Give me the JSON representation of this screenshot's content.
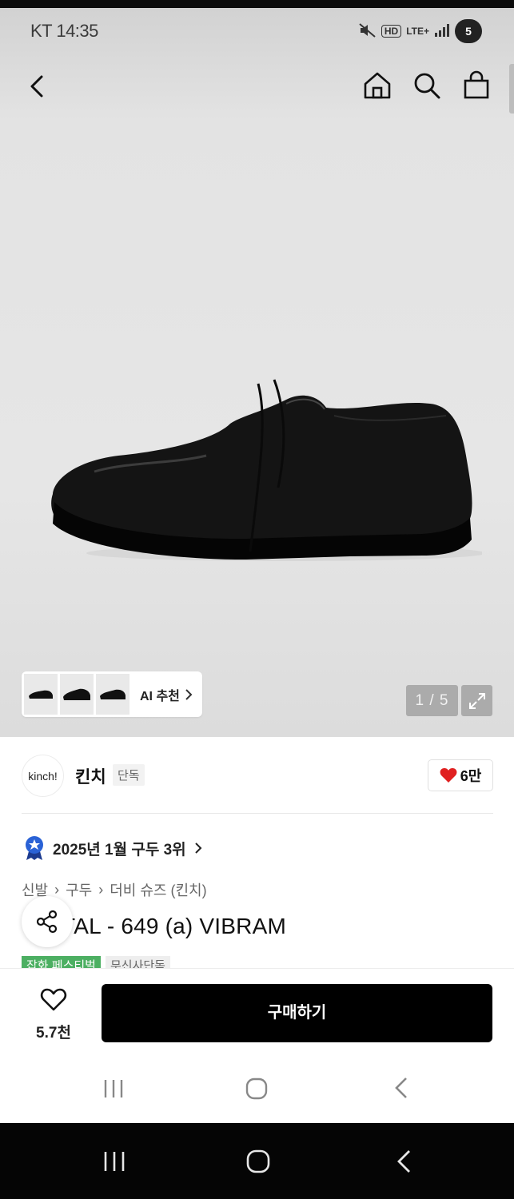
{
  "status": {
    "time": "KT 14:35",
    "icons": [
      "mute-icon",
      "hd-icon",
      "lte-icon",
      "signal-icon",
      "battery-icon"
    ],
    "net_label": "LTE+",
    "hd_label": "HD",
    "badge": "5"
  },
  "nav": {
    "icons": [
      "back-icon",
      "home-icon",
      "search-icon",
      "cart-icon"
    ]
  },
  "gallery": {
    "ai_recommend": "AI 추천",
    "counter": "1 / 5"
  },
  "brand": {
    "logo_text": "kinch!",
    "name": "킨치",
    "tag": "단독",
    "likes": "6만"
  },
  "ranking": {
    "text": "2025년 1월 구두 3위"
  },
  "breadcrumb": [
    "신발",
    "구두",
    "더비 슈즈 (킨치)"
  ],
  "product": {
    "title": "TAL - 649 (a) VIBRAM"
  },
  "badges": [
    "잡화 페스티벌",
    "무신사단독"
  ],
  "bottom": {
    "wish_count": "5.7천",
    "buy_label": "구매하기"
  },
  "colors": {
    "accent": "#000000",
    "heart": "#e02020",
    "badge_green": "#4caf62"
  }
}
